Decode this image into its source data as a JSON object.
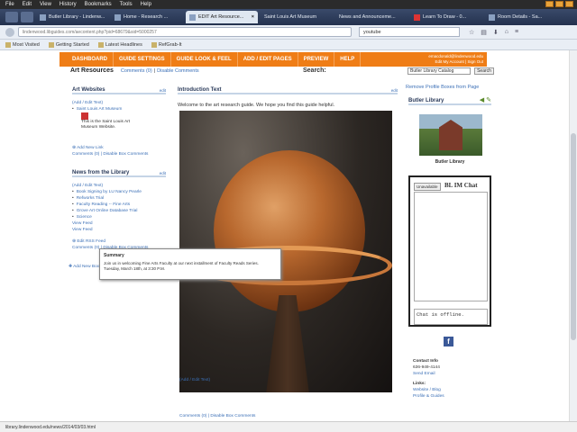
{
  "menubar": [
    "File",
    "Edit",
    "View",
    "History",
    "Bookmarks",
    "Tools",
    "Help"
  ],
  "tabs": [
    {
      "label": "Butler Library - Lindenw...",
      "active": false
    },
    {
      "label": "Home - Research ...",
      "active": false
    },
    {
      "label": "EDIT Art Resource...",
      "active": true
    },
    {
      "label": "Saint Louis Art Museum",
      "active": false
    },
    {
      "label": "News and Announceme...",
      "active": false
    },
    {
      "label": "Learn To Draw - 0...",
      "active": false
    },
    {
      "label": "Room Details - Sa...",
      "active": false
    }
  ],
  "url": "lindenwood.libguides.com/aecontent.php?pid=68679&sid=5000257",
  "search_value": "youtube",
  "bookmarks": [
    "Most Visited",
    "Getting Started",
    "Latest Headlines",
    "RefGrab-It"
  ],
  "nav": [
    "DASHBOARD",
    "GUIDE SETTINGS",
    "GUIDE LOOK & FEEL",
    "ADD / EDIT PAGES",
    "PREVIEW",
    "HELP"
  ],
  "user": {
    "email": "emacdonald@lindenwood.edu",
    "links": "Edit My Account | Sign Out"
  },
  "page": {
    "title": "Art Resources",
    "comments": "Comments (0)",
    "disable": "Disable Comments",
    "search_label": "Search:",
    "catalog": "Butler Library Catalog",
    "go": "Search"
  },
  "remove_boxes": "Remove Profile Boxes from Page",
  "art_websites": {
    "title": "Art Websites",
    "edit": "edit",
    "addedit": "(Add / Edit Text)",
    "link": "Saint Louis Art Museum",
    "desc": "This is the Saint Louis Art Museum Website.",
    "add": "Add New Link",
    "comments": "Comments (0)",
    "disable": "Disable Box Comments"
  },
  "news": {
    "title": "News from the Library",
    "edit": "edit",
    "addedit": "(Add / Edit Text)",
    "items": [
      "Book Signing by LU Nancy Pearle",
      "Refworks Trial",
      "Faculty Reading -- Fine Arts",
      "Grove Art Online Database Trial",
      "Science"
    ],
    "view1": "View Feed",
    "view2": "View Feed",
    "rss": "Edit RSS Feed",
    "comments": "Comments (0)",
    "disable": "Disable Box Comments"
  },
  "add_box": "Add New Box",
  "intro": {
    "title": "Introduction Text",
    "edit": "edit",
    "text": "Welcome to the art research guide. We hope you find this guide helpful.",
    "addedit": "(Add / Edit Text)",
    "comments": "Comments (0)",
    "disable": "Disable Box Comments"
  },
  "tooltip": {
    "title": "Summary",
    "line1": "Join us in welcoming Fine Arts Faculty at our next installment of Faculty Reads Series.",
    "line2": "Tuesday, March 18th, at 3:30 P.M."
  },
  "profile": {
    "title": "Butler Library",
    "caption": "Butler Library"
  },
  "chat": {
    "button": "Unavailable",
    "title": "BL IM Chat",
    "status": "Chat is offline."
  },
  "contact": {
    "heading": "Contact Info",
    "phone": "636-949-4144",
    "email": "Send Email",
    "links_heading": "Links:",
    "link1": "Website / Blog",
    "link2": "Profile & Guides"
  },
  "status_url": "library.lindenwood.edu/news/2014/03/03.html"
}
